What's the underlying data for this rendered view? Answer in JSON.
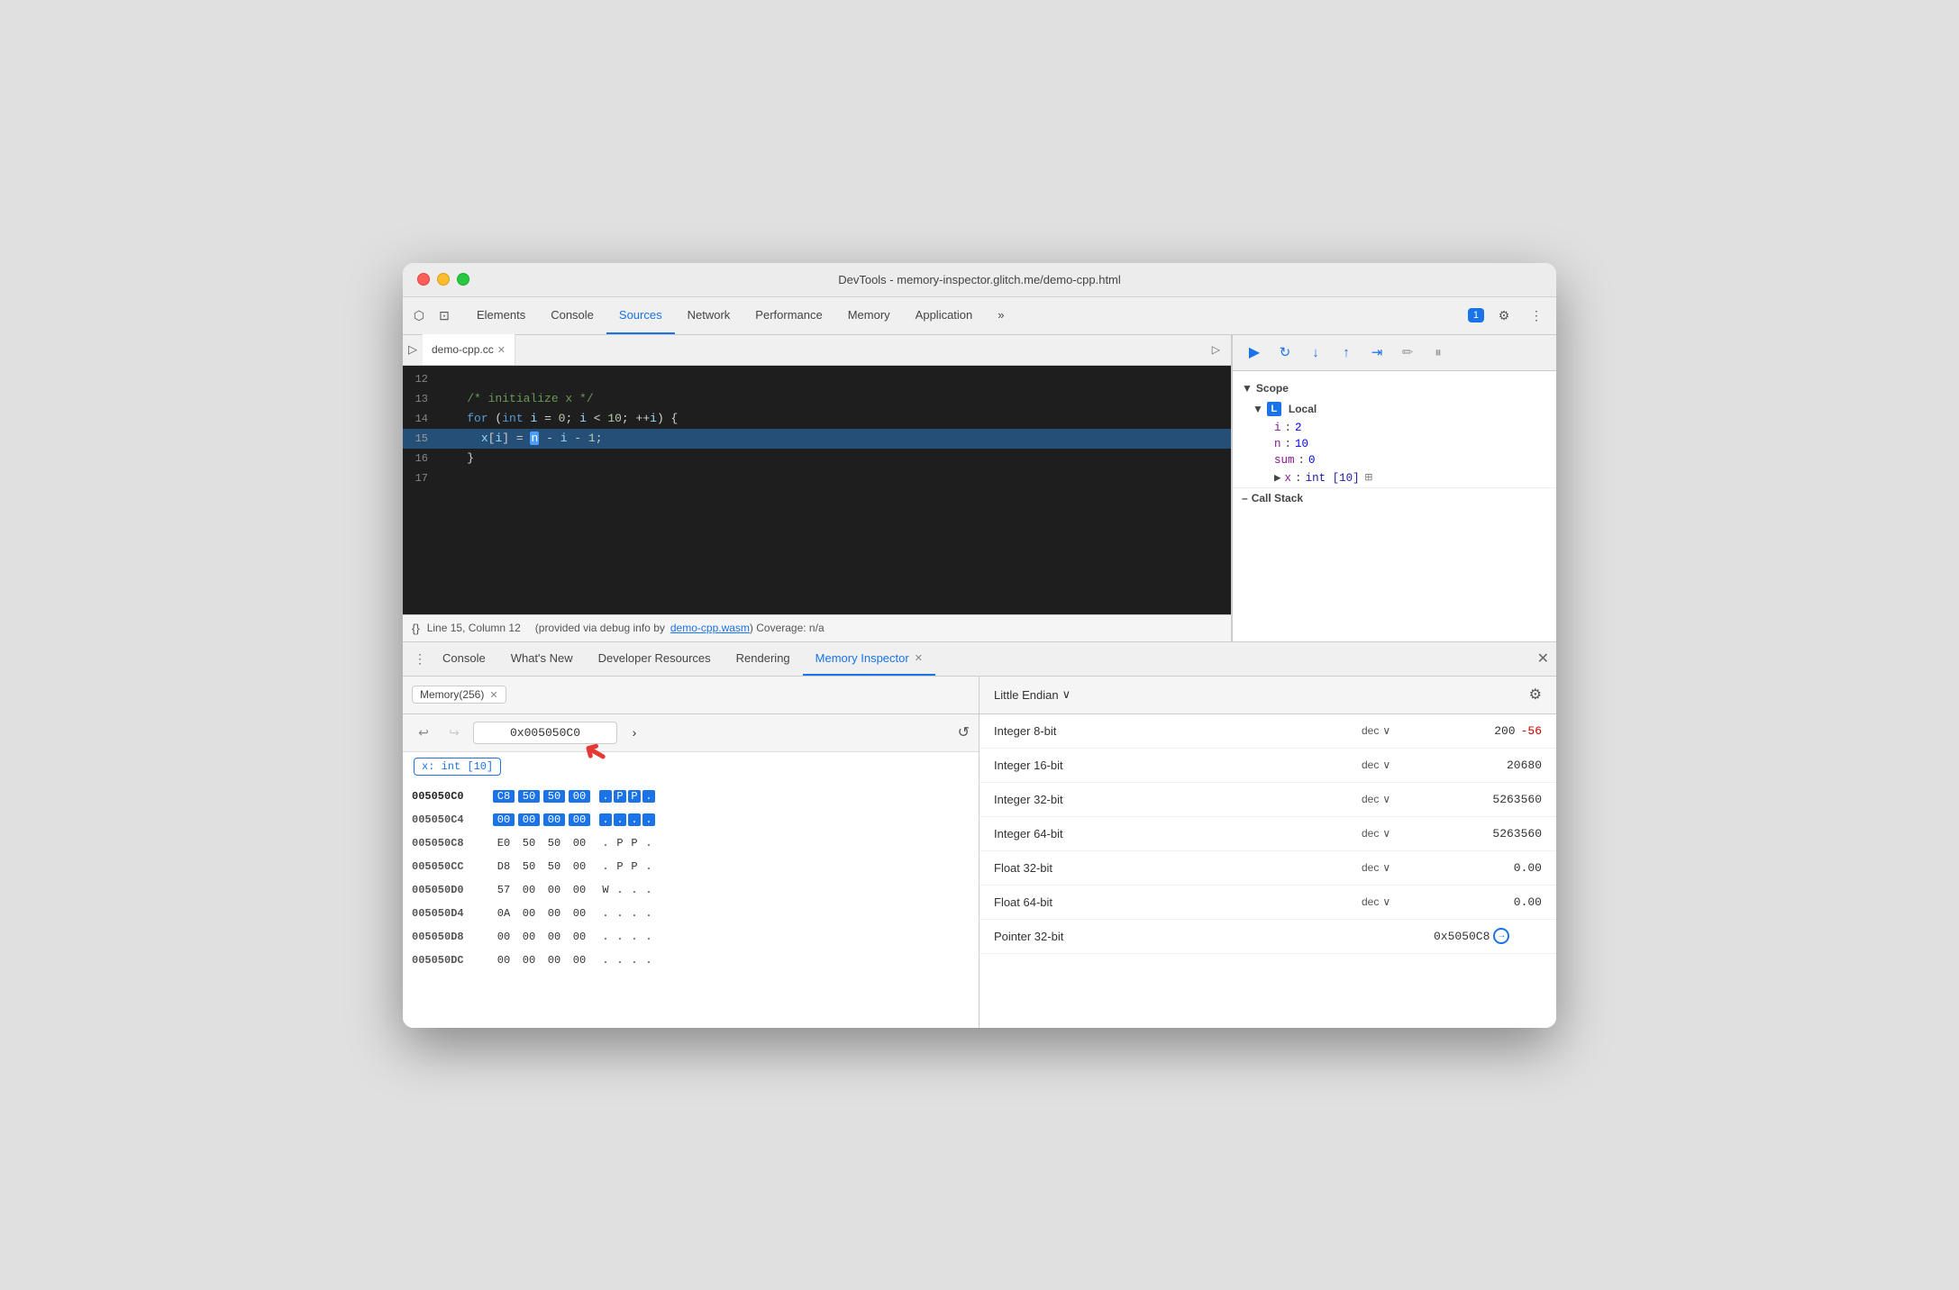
{
  "window": {
    "title": "DevTools - memory-inspector.glitch.me/demo-cpp.html"
  },
  "top_tabs": {
    "items": [
      {
        "label": "Elements",
        "active": false
      },
      {
        "label": "Console",
        "active": false
      },
      {
        "label": "Sources",
        "active": true
      },
      {
        "label": "Network",
        "active": false
      },
      {
        "label": "Performance",
        "active": false
      },
      {
        "label": "Memory",
        "active": false
      },
      {
        "label": "Application",
        "active": false
      },
      {
        "label": "»",
        "active": false
      }
    ],
    "chat_badge": "1",
    "more_icon": "⚙",
    "dots_icon": "⋮"
  },
  "sources_panel": {
    "file_tab": "demo-cpp.cc",
    "code_lines": [
      {
        "num": "12",
        "content": ""
      },
      {
        "num": "13",
        "content": "  /* initialize x */"
      },
      {
        "num": "14",
        "content": "  for (int i = 0; i < 10; ++i) {"
      },
      {
        "num": "15",
        "content": "    x[i] = n - i - 1;",
        "highlighted": true
      },
      {
        "num": "16",
        "content": "  }"
      },
      {
        "num": "17",
        "content": ""
      }
    ],
    "status_bar": {
      "position": "Line 15, Column 12",
      "debug_info": "(provided via debug info by",
      "wasm_link": "demo-cpp.wasm",
      "coverage": ") Coverage: n/a"
    }
  },
  "debugger": {
    "buttons": [
      "▶",
      "↻",
      "↓",
      "↑",
      "⇥",
      "✏",
      "⏸"
    ]
  },
  "scope": {
    "title": "Scope",
    "local_section": "Local",
    "vars": [
      {
        "name": "i",
        "colon": ":",
        "value": "2"
      },
      {
        "name": "n",
        "colon": ":",
        "value": "10"
      },
      {
        "name": "sum",
        "colon": ":",
        "value": "0"
      },
      {
        "name": "x",
        "colon": ":",
        "value": "int [10]",
        "has_icon": true,
        "expandable": true
      }
    ],
    "call_stack_title": "Call Stack"
  },
  "bottom_tabs": {
    "items": [
      {
        "label": "Console",
        "active": false
      },
      {
        "label": "What's New",
        "active": false
      },
      {
        "label": "Developer Resources",
        "active": false
      },
      {
        "label": "Rendering",
        "active": false
      },
      {
        "label": "Memory Inspector",
        "active": true,
        "closable": true
      }
    ]
  },
  "memory_inspector": {
    "tab_label": "Memory(256)",
    "address": "0x005050C0",
    "endian": "Little Endian",
    "var_badge": "x: int [10]",
    "hex_rows": [
      {
        "address": "005050C0",
        "bold": true,
        "bytes": [
          "C8",
          "50",
          "50",
          "00"
        ],
        "ascii": [
          ".",
          "P",
          "P",
          "."
        ],
        "selected": [
          0,
          1,
          2,
          3
        ]
      },
      {
        "address": "005050C4",
        "bytes": [
          "00",
          "00",
          "00",
          "00"
        ],
        "ascii": [
          ".",
          ".",
          ".",
          "."
        ],
        "selected": [
          0,
          1,
          2,
          3
        ]
      },
      {
        "address": "005050C8",
        "bytes": [
          "E0",
          "50",
          "50",
          "00"
        ],
        "ascii": [
          ".",
          "P",
          "P",
          "."
        ]
      },
      {
        "address": "005050CC",
        "bytes": [
          "D8",
          "50",
          "50",
          "00"
        ],
        "ascii": [
          ".",
          "P",
          "P",
          "."
        ]
      },
      {
        "address": "005050D0",
        "bytes": [
          "57",
          "00",
          "00",
          "00"
        ],
        "ascii": [
          "W",
          ".",
          ".",
          "."
        ]
      },
      {
        "address": "005050D4",
        "bytes": [
          "0A",
          "00",
          "00",
          "00"
        ],
        "ascii": [
          ".",
          ".",
          ".",
          "."
        ]
      },
      {
        "address": "005050D8",
        "bytes": [
          "00",
          "00",
          "00",
          "00"
        ],
        "ascii": [
          ".",
          ".",
          ".",
          "."
        ]
      },
      {
        "address": "005050DC",
        "bytes": [
          "00",
          "00",
          "00",
          "00"
        ],
        "ascii": [
          ".",
          ".",
          ".",
          "."
        ]
      }
    ],
    "inspector": {
      "endian_label": "Little Endian",
      "rows": [
        {
          "label": "Integer 8-bit",
          "type": "dec",
          "value": "200",
          "neg": "-56"
        },
        {
          "label": "Integer 16-bit",
          "type": "dec",
          "value": "20680"
        },
        {
          "label": "Integer 32-bit",
          "type": "dec",
          "value": "5263560"
        },
        {
          "label": "Integer 64-bit",
          "type": "dec",
          "value": "5263560"
        },
        {
          "label": "Float 32-bit",
          "type": "dec",
          "value": "0.00"
        },
        {
          "label": "Float 64-bit",
          "type": "dec",
          "value": "0.00"
        },
        {
          "label": "Pointer 32-bit",
          "type": "",
          "value": "0x5050C8",
          "link": true
        }
      ]
    }
  }
}
